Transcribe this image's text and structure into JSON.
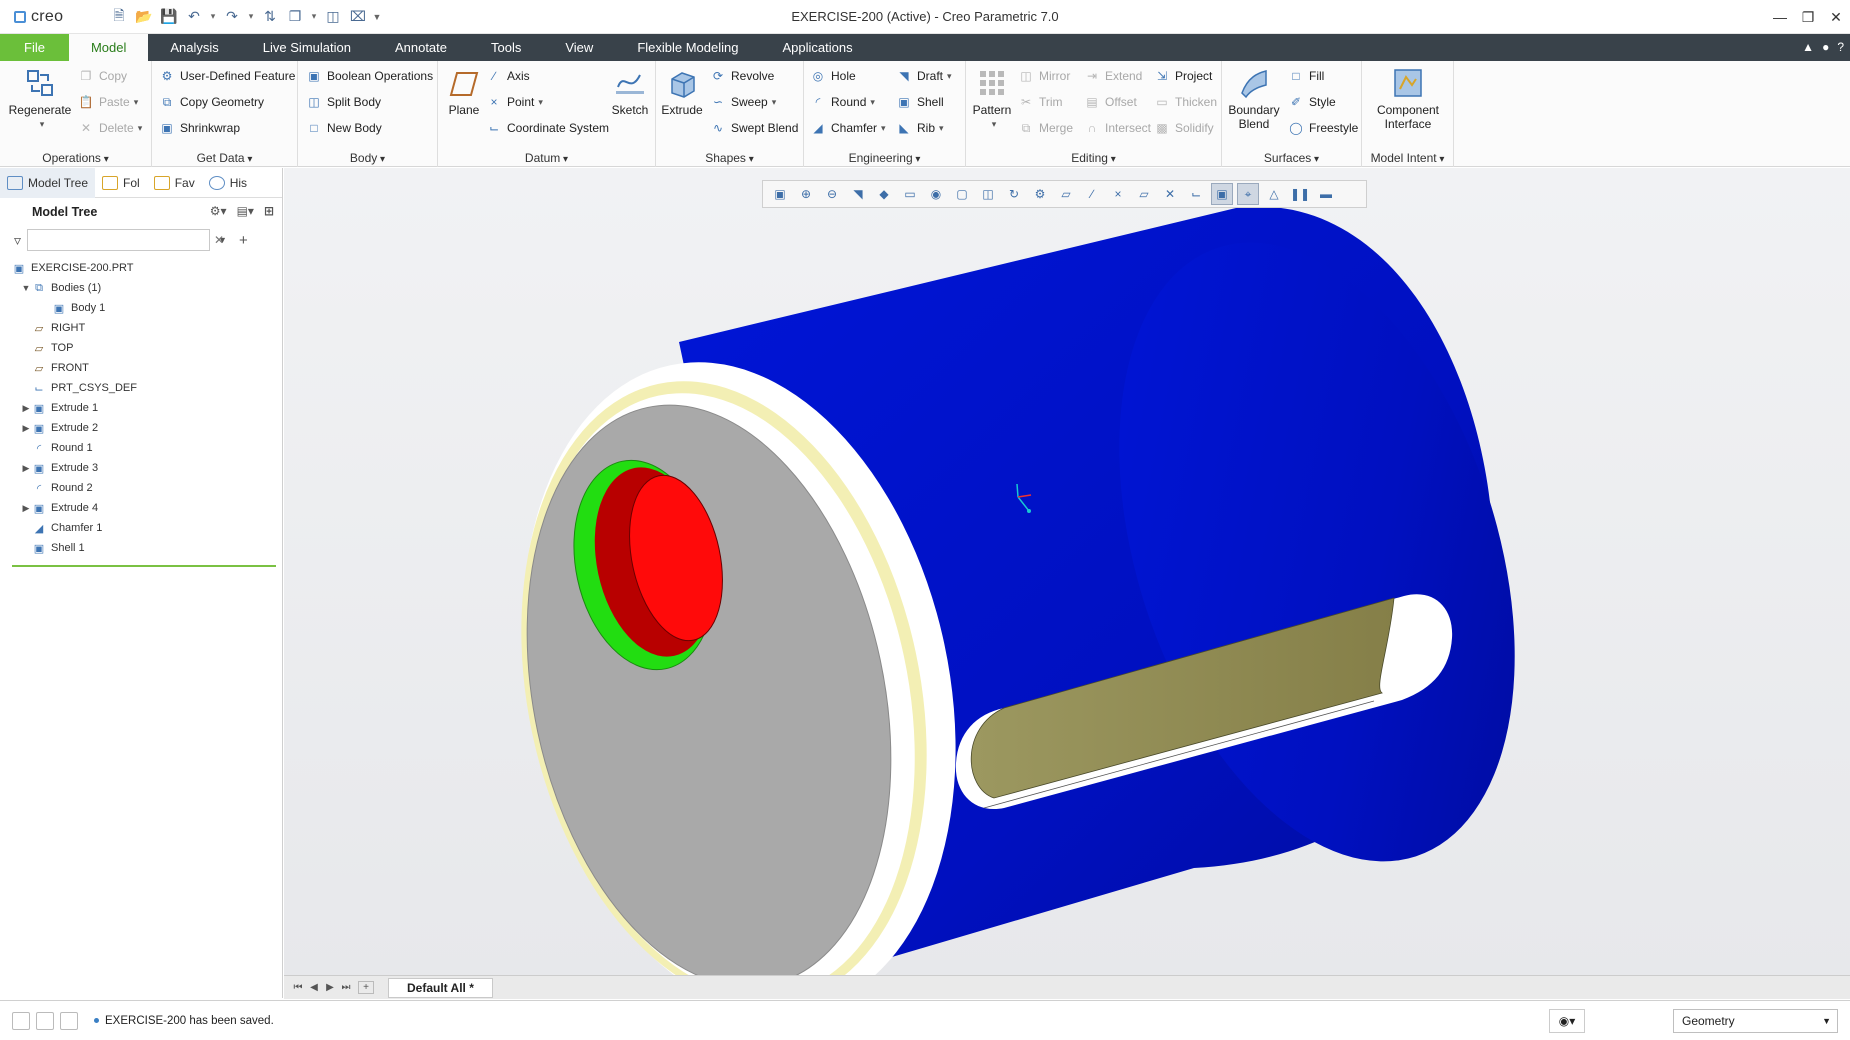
{
  "app": {
    "logo_text": "creo",
    "window_title": "EXERCISE-200 (Active) - Creo Parametric 7.0"
  },
  "tabs": [
    {
      "label": "File"
    },
    {
      "label": "Model"
    },
    {
      "label": "Analysis"
    },
    {
      "label": "Live Simulation"
    },
    {
      "label": "Annotate"
    },
    {
      "label": "Tools"
    },
    {
      "label": "View"
    },
    {
      "label": "Flexible Modeling"
    },
    {
      "label": "Applications"
    }
  ],
  "ribbon": {
    "operations": {
      "label": "Operations",
      "regenerate": "Regenerate",
      "copy": "Copy",
      "paste": "Paste",
      "delete": "Delete"
    },
    "get_data": {
      "label": "Get Data",
      "udf": "User-Defined Feature",
      "copy_geometry": "Copy Geometry",
      "shrinkwrap": "Shrinkwrap"
    },
    "body": {
      "label": "Body",
      "boolean": "Boolean Operations",
      "split": "Split Body",
      "new": "New Body"
    },
    "datum": {
      "label": "Datum",
      "plane": "Plane",
      "axis": "Axis",
      "point": "Point",
      "csys": "Coordinate System",
      "sketch": "Sketch"
    },
    "shapes": {
      "label": "Shapes",
      "extrude": "Extrude",
      "revolve": "Revolve",
      "sweep": "Sweep",
      "swept_blend": "Swept Blend"
    },
    "engineering": {
      "label": "Engineering",
      "hole": "Hole",
      "round": "Round",
      "chamfer": "Chamfer",
      "draft": "Draft",
      "shell": "Shell",
      "rib": "Rib"
    },
    "editing": {
      "label": "Editing",
      "pattern": "Pattern",
      "mirror": "Mirror",
      "trim": "Trim",
      "merge": "Merge",
      "extend": "Extend",
      "offset": "Offset",
      "intersect": "Intersect",
      "project": "Project",
      "thicken": "Thicken",
      "solidify": "Solidify"
    },
    "surfaces": {
      "label": "Surfaces",
      "boundary_blend_1": "Boundary",
      "boundary_blend_2": "Blend",
      "fill": "Fill",
      "style": "Style",
      "freestyle": "Freestyle"
    },
    "model_intent": {
      "label": "Model Intent",
      "component_1": "Component",
      "component_2": "Interface"
    }
  },
  "panel": {
    "tabs": [
      {
        "label": "Model Tree"
      },
      {
        "label": "Fol"
      },
      {
        "label": "Fav"
      },
      {
        "label": "His"
      }
    ],
    "header": "Model Tree",
    "search_value": ""
  },
  "tree": [
    {
      "label": "EXERCISE-200.PRT",
      "icon": "part-icon"
    },
    {
      "label": "Bodies (1)",
      "icon": "bodies-icon",
      "expanded": true
    },
    {
      "label": "Body 1",
      "icon": "body-icon"
    },
    {
      "label": "RIGHT",
      "icon": "datum-plane-icon"
    },
    {
      "label": "TOP",
      "icon": "datum-plane-icon"
    },
    {
      "label": "FRONT",
      "icon": "datum-plane-icon"
    },
    {
      "label": "PRT_CSYS_DEF",
      "icon": "csys-icon"
    },
    {
      "label": "Extrude 1",
      "icon": "extrude-icon",
      "collapsed": true
    },
    {
      "label": "Extrude 2",
      "icon": "extrude-icon",
      "collapsed": true
    },
    {
      "label": "Round 1",
      "icon": "round-icon"
    },
    {
      "label": "Extrude 3",
      "icon": "extrude-icon",
      "collapsed": true
    },
    {
      "label": "Round 2",
      "icon": "round-icon"
    },
    {
      "label": "Extrude 4",
      "icon": "extrude-icon",
      "collapsed": true
    },
    {
      "label": "Chamfer 1",
      "icon": "chamfer-icon"
    },
    {
      "label": "Shell 1",
      "icon": "shell-icon"
    }
  ],
  "window_tab": "Default All *",
  "status": {
    "message": "EXERCISE-200 has been saved.",
    "filter": "Geometry"
  },
  "colors": {
    "file_tab": "#6bbf3a",
    "tab_bar": "#39424a",
    "body_blue": "#0010c8",
    "hole_red": "#e00000",
    "hole_green": "#22dd11",
    "slot_olive": "#8f8a52"
  }
}
